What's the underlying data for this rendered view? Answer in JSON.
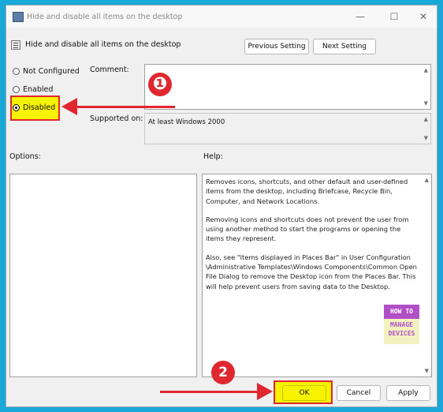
{
  "window": {
    "title": "Hide and disable all items on the desktop",
    "controls": {
      "minimize": "—",
      "maximize": "☐",
      "close": "✕"
    }
  },
  "header": {
    "policy_name": "Hide and disable all items on the desktop",
    "previous_label": "Previous Setting",
    "next_label": "Next Setting"
  },
  "state": {
    "options": [
      {
        "label": "Not Configured",
        "checked": false
      },
      {
        "label": "Enabled",
        "checked": false
      },
      {
        "label": "Disabled",
        "checked": true
      }
    ]
  },
  "comment": {
    "label": "Comment:",
    "value": ""
  },
  "supported": {
    "label": "Supported on:",
    "value": "At least Windows 2000"
  },
  "options_panel": {
    "label": "Options:"
  },
  "help": {
    "label": "Help:",
    "paragraphs": [
      "Removes icons, shortcuts, and other default and user-defined items from the desktop, including Briefcase, Recycle Bin, Computer, and Network Locations.",
      "Removing icons and shortcuts does not prevent the user from using another method to start the programs or opening the items they represent.",
      "Also, see \"Items displayed in Places Bar\" in User Configuration \\Administrative Templates\\Windows Components\\Common Open File Dialog to remove the Desktop icon from the Places Bar. This will help prevent users from saving data to the Desktop."
    ]
  },
  "logo": {
    "line1": "HOW TO",
    "line2": "MANAGE",
    "line3": "DEVICES"
  },
  "footer": {
    "ok_label": "OK",
    "cancel_label": "Cancel",
    "apply_label": "Apply"
  },
  "annotations": {
    "step1": "❶",
    "step2": "2"
  },
  "colors": {
    "background": "#1aa8d8",
    "highlight": "#f7f300",
    "annotation_red": "#e0262e"
  }
}
